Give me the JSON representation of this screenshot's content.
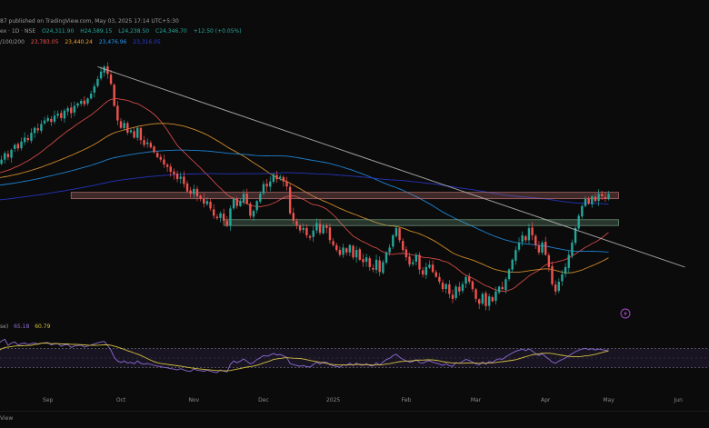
{
  "header": {
    "publish_line": "87 published on TradingView.com, May 03, 2025 17:14 UTC+5:30",
    "symbol_line": {
      "symbol": "ex · 1D · NSE",
      "open": "O24,311.90",
      "high": "H24,589.15",
      "low": "L24,238.50",
      "close": "C24,346.70",
      "change": "+12.50 (+0.05%)"
    },
    "ma_line": {
      "label": "/100/200",
      "ma1": "23,783.05",
      "ma2": "23,440.24",
      "ma3": "23,476.96",
      "ma4": "23,316.05"
    }
  },
  "rsi": {
    "label": "se)",
    "value1": "65.18",
    "value2": "60.79"
  },
  "x_axis": {
    "ticks": [
      {
        "label": "Sep",
        "i": 18
      },
      {
        "label": "Oct",
        "i": 40
      },
      {
        "label": "Nov",
        "i": 62
      },
      {
        "label": "Dec",
        "i": 83
      },
      {
        "label": "2025",
        "i": 104
      },
      {
        "label": "Feb",
        "i": 126
      },
      {
        "label": "Mar",
        "i": 147
      },
      {
        "label": "Apr",
        "i": 168
      },
      {
        "label": "May",
        "i": 187
      },
      {
        "label": "Jun",
        "i": 208
      }
    ]
  },
  "bottom_bar": {
    "label": "View"
  },
  "colors": {
    "up": "#26a69a",
    "down": "#ef5350",
    "ma1": "#ef5350",
    "ma2": "#f0a030",
    "ma3": "#2196f3",
    "ma4": "#2a3bd8",
    "trendline": "#b8b8b8",
    "rsi": "#8e6bd8",
    "rsi_ma": "#d4c040",
    "resistance_zone": "#c87b7b",
    "support_zone": "#7ba88a"
  },
  "icons": {
    "flash": "lightning-icon"
  },
  "chart_data": {
    "type": "candlestick",
    "index_base": 0,
    "close": [
      24800,
      24880,
      24830,
      24950,
      25050,
      25180,
      25100,
      25250,
      25350,
      25280,
      25420,
      25500,
      25450,
      25600,
      25700,
      25650,
      25780,
      25850,
      25900,
      25820,
      25950,
      25990,
      25900,
      26050,
      26100,
      26000,
      26150,
      26200,
      26250,
      26180,
      26300,
      26400,
      26550,
      26700,
      26850,
      26950,
      26800,
      26600,
      26150,
      25850,
      25700,
      25800,
      25600,
      25650,
      25500,
      25700,
      25450,
      25350,
      25400,
      25300,
      25200,
      25100,
      25050,
      24950,
      24900,
      24800,
      24750,
      24650,
      24700,
      24550,
      24400,
      24350,
      24450,
      24300,
      24250,
      24150,
      24200,
      24050,
      23900,
      23850,
      23950,
      23800,
      23700,
      24050,
      24250,
      24100,
      24200,
      24350,
      24150,
      23900,
      24000,
      24200,
      24350,
      24550,
      24500,
      24600,
      24750,
      24650,
      24700,
      24600,
      24500,
      23950,
      23800,
      23700,
      23600,
      23650,
      23500,
      23450,
      23600,
      23750,
      23550,
      23700,
      23650,
      23400,
      23300,
      23200,
      23100,
      23250,
      23150,
      23300,
      23050,
      23200,
      23000,
      22950,
      23050,
      22850,
      22800,
      23000,
      22750,
      22950,
      23150,
      23250,
      23500,
      23650,
      23400,
      23200,
      23050,
      22900,
      22950,
      23100,
      22800,
      22700,
      22850,
      22900,
      22750,
      22650,
      22550,
      22400,
      22500,
      22300,
      22200,
      22450,
      22350,
      22500,
      22650,
      22550,
      22400,
      22200,
      22100,
      22300,
      22050,
      22250,
      22150,
      22350,
      22450,
      22400,
      22600,
      22800,
      23000,
      23200,
      23350,
      23500,
      23400,
      23650,
      23500,
      23300,
      23150,
      23350,
      23100,
      22850,
      22500,
      22350,
      22550,
      22700,
      22850,
      23100,
      23350,
      23650,
      23900,
      24100,
      24250,
      24150,
      24300,
      24200,
      24350,
      24300,
      24250,
      24346.7
    ],
    "ylim": [
      21900,
      27200
    ],
    "overlays": {
      "trendline": {
        "from": {
          "i": 33,
          "y": 26950
        },
        "to": {
          "i": 210,
          "y": 22850
        }
      },
      "resistance_zone": {
        "i_from": 25,
        "i_to": 190,
        "y_from": 24250,
        "y_to": 24380
      },
      "support_zone": {
        "i_from": 71,
        "i_to": 190,
        "y_from": 23700,
        "y_to": 23820
      }
    },
    "rsi_panel": {
      "upper": 70,
      "lower": 30,
      "ylim": [
        0,
        100
      ]
    },
    "moving_averages": [
      {
        "period": 20,
        "color_key": "ma1"
      },
      {
        "period": 50,
        "color_key": "ma2"
      },
      {
        "period": 100,
        "color_key": "ma3"
      },
      {
        "period": 200,
        "color_key": "ma4"
      }
    ]
  }
}
